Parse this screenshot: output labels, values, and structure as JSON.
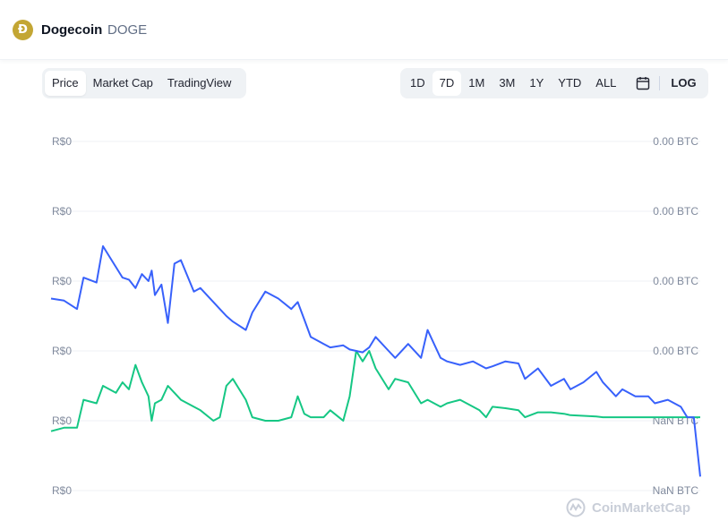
{
  "header": {
    "coin_logo_glyph": "Ð",
    "coin_name": "Dogecoin",
    "coin_symbol": "DOGE"
  },
  "view_tabs": [
    {
      "label": "Price",
      "active": true
    },
    {
      "label": "Market Cap",
      "active": false
    },
    {
      "label": "TradingView",
      "active": false
    }
  ],
  "range_tabs": [
    {
      "label": "1D",
      "active": false
    },
    {
      "label": "7D",
      "active": true
    },
    {
      "label": "1M",
      "active": false
    },
    {
      "label": "3M",
      "active": false
    },
    {
      "label": "1Y",
      "active": false
    },
    {
      "label": "YTD",
      "active": false
    },
    {
      "label": "ALL",
      "active": false
    }
  ],
  "calendar_icon": "calendar-icon",
  "log_label": "LOG",
  "watermark": {
    "logo_icon": "coinmarketcap-logo-icon",
    "text": "CoinMarketCap"
  },
  "colors": {
    "price_line": "#3861fb",
    "btc_line": "#16c784",
    "grid": "#eff2f5",
    "axis_text": "#808a9d"
  },
  "chart_data": {
    "type": "line",
    "title": "",
    "xlabel": "",
    "ylabel": "",
    "left_axis_ticks": [
      "R$0",
      "R$0",
      "R$0",
      "R$0",
      "R$0",
      "R$0"
    ],
    "right_axis_ticks": [
      "0.00 BTC",
      "0.00 BTC",
      "0.00 BTC",
      "0.00 BTC",
      "NaN BTC",
      "NaN BTC"
    ],
    "ylim": [
      0,
      5
    ],
    "x": [
      0,
      2,
      4,
      5,
      7,
      8,
      10,
      11,
      12,
      13,
      14,
      15,
      15.5,
      16,
      17,
      18,
      19,
      20,
      22,
      23,
      25,
      26,
      27,
      28,
      30,
      31,
      33,
      35,
      37,
      38,
      39,
      40,
      42,
      43,
      45,
      46,
      47,
      48,
      49,
      50,
      52,
      53,
      55,
      57,
      58,
      60,
      61,
      63,
      65,
      66,
      67,
      68,
      70,
      72,
      73,
      75,
      77,
      79,
      80,
      82,
      84,
      85,
      87,
      88,
      90,
      92,
      93,
      95,
      97,
      98,
      99,
      100
    ],
    "series": [
      {
        "values": [
          2.75,
          2.72,
          2.6,
          3.05,
          2.98,
          3.5,
          3.2,
          3.05,
          3.02,
          2.9,
          3.1,
          3.0,
          3.15,
          2.8,
          2.95,
          2.4,
          3.25,
          3.3,
          2.85,
          2.9,
          2.7,
          2.6,
          2.5,
          2.42,
          2.3,
          2.55,
          2.85,
          2.75,
          2.6,
          2.7,
          2.45,
          2.2,
          2.1,
          2.05,
          2.08,
          2.02,
          2.0,
          1.98,
          2.05,
          2.2,
          2.0,
          1.9,
          2.1,
          1.9,
          2.3,
          1.9,
          1.85,
          1.8,
          1.85,
          1.8,
          1.75,
          1.78,
          1.85,
          1.82,
          1.6,
          1.75,
          1.5,
          1.6,
          1.45,
          1.55,
          1.7,
          1.55,
          1.35,
          1.45,
          1.35,
          1.35,
          1.25,
          1.3,
          1.2,
          1.05,
          1.05,
          0.2
        ]
      },
      {
        "values": [
          0.85,
          0.9,
          0.9,
          1.3,
          1.25,
          1.5,
          1.4,
          1.55,
          1.45,
          1.8,
          1.55,
          1.35,
          1.0,
          1.25,
          1.3,
          1.5,
          1.4,
          1.3,
          1.2,
          1.15,
          1.0,
          1.05,
          1.5,
          1.6,
          1.3,
          1.05,
          1.0,
          1.0,
          1.05,
          1.35,
          1.1,
          1.05,
          1.05,
          1.15,
          1.0,
          1.35,
          2.0,
          1.85,
          2.0,
          1.75,
          1.45,
          1.6,
          1.55,
          1.25,
          1.3,
          1.2,
          1.25,
          1.3,
          1.2,
          1.15,
          1.05,
          1.2,
          1.18,
          1.15,
          1.05,
          1.12,
          1.12,
          1.1,
          1.08,
          1.07,
          1.06,
          1.05,
          1.05,
          1.05,
          1.05,
          1.05,
          1.05,
          1.05,
          1.05,
          1.05,
          1.05,
          1.05
        ]
      }
    ]
  }
}
